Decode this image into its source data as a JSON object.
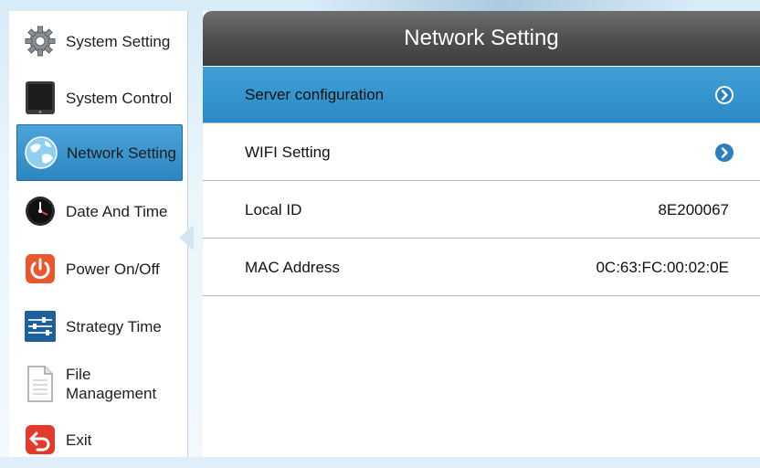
{
  "sidebar": {
    "items": [
      {
        "label": "System Setting",
        "icon": "gear-icon"
      },
      {
        "label": "System Control",
        "icon": "tablet-icon"
      },
      {
        "label": "Network Setting",
        "icon": "globe-icon",
        "selected": true
      },
      {
        "label": "Date And Time",
        "icon": "clock-icon"
      },
      {
        "label": "Power On/Off",
        "icon": "power-icon"
      },
      {
        "label": "Strategy Time",
        "icon": "sliders-icon"
      },
      {
        "label": "File Management",
        "label_line1": "File",
        "label_line2": "Management",
        "icon": "document-icon"
      },
      {
        "label": "Exit",
        "icon": "exit-icon"
      }
    ]
  },
  "main": {
    "title": "Network Setting",
    "rows": [
      {
        "label": "Server configuration",
        "type": "link",
        "selected": true
      },
      {
        "label": "WIFI Setting",
        "type": "link"
      },
      {
        "label": "Local ID",
        "value": "8E200067"
      },
      {
        "label": "MAC Address",
        "value": "0C:63:FC:00:02:0E"
      }
    ]
  },
  "colors": {
    "accent": "#2e86c1",
    "header": "#4f4f4f",
    "background": "#dfeef8"
  }
}
